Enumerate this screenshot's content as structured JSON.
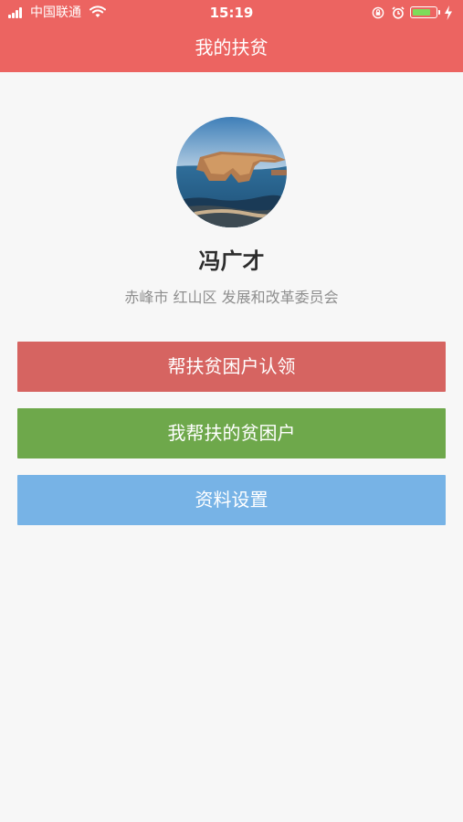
{
  "status_bar": {
    "carrier": "中国联通",
    "time": "15:19",
    "signal_bars": 4,
    "battery_level": 0.82
  },
  "nav": {
    "title": "我的扶贫"
  },
  "profile": {
    "name": "冯广才",
    "organization": "赤峰市 红山区 发展和改革委员会"
  },
  "actions": [
    {
      "label": "帮扶贫困户认领",
      "color": "#d66461"
    },
    {
      "label": "我帮扶的贫困户",
      "color": "#6ea84b"
    },
    {
      "label": "资料设置",
      "color": "#77b3e6"
    }
  ],
  "colors": {
    "nav_bar": "#ec6461",
    "background": "#f7f7f7",
    "battery_fill": "#7ddc5a"
  }
}
